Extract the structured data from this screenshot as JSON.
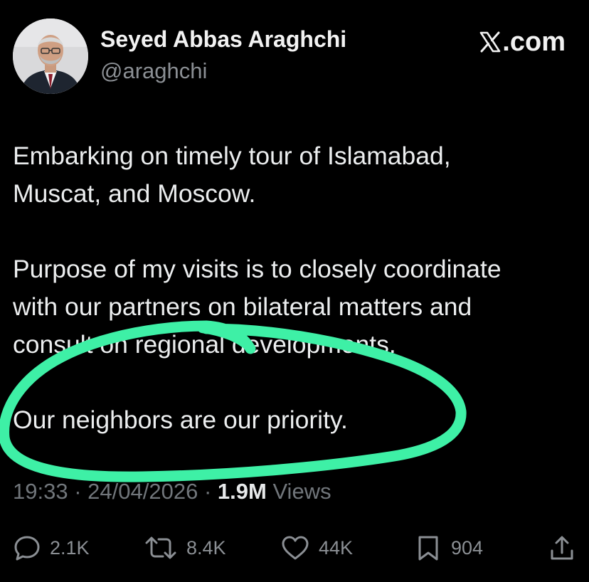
{
  "tweet": {
    "author": {
      "display_name": "Seyed Abbas Araghchi",
      "handle": "@araghchi"
    },
    "brand": {
      "text": ".com"
    },
    "body": {
      "line1": "Embarking on timely tour of Islamabad,",
      "line2": "Muscat, and Moscow.",
      "line3": "Purpose of my visits is to closely coordinate",
      "line4": "with our partners on bilateral matters and",
      "line5": "consult on regional developments.",
      "line6": "Our neighbors are our priority."
    },
    "meta": {
      "time": "19:33",
      "separator": "·",
      "date": "24/04/2026",
      "views_count": "1.9M",
      "views_label": "Views"
    },
    "actions": {
      "replies": "2.1K",
      "reposts": "8.4K",
      "likes": "44K",
      "bookmarks": "904"
    }
  },
  "colors": {
    "background": "#000000",
    "text": "#e7e9ea",
    "secondary": "#71767b",
    "annotation": "#3ef0a6"
  },
  "icons": {
    "reply": "speech-bubble-icon",
    "repost": "repost-arrows-icon",
    "like": "heart-icon",
    "bookmark": "bookmark-icon",
    "share": "share-upload-icon",
    "brand": "x-logo-icon"
  }
}
